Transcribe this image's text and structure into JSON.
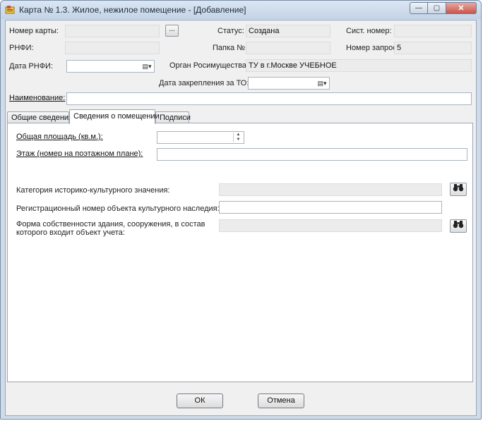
{
  "window": {
    "title": "Карта № 1.3. Жилое, нежилое помещение - [Добавление]",
    "minimize": "—",
    "maximize": "▢",
    "close": "✕"
  },
  "header": {
    "card_number_label": "Номер карты:",
    "card_number_value": "",
    "browse_button": "...",
    "status_label": "Статус:",
    "status_value": "Создана",
    "sys_number_label": "Сист. номер:",
    "sys_number_value": "",
    "rnfi_label": "РНФИ:",
    "rnfi_value": "",
    "folder_label": "Папка №:",
    "folder_value": "",
    "request_number_label": "Номер запроса:",
    "request_number_value": "5",
    "rnfi_date_label": "Дата РНФИ:",
    "rnfi_date_value": "",
    "authority_label": "Орган Росимущества:",
    "authority_value": "ТУ в г.Москве УЧЕБНОЕ",
    "assignment_date_label": "Дата закрепления за ТО:",
    "assignment_date_value": "",
    "name_label": "Наименование:",
    "name_value": ""
  },
  "tabs": [
    {
      "label": "Общие сведения"
    },
    {
      "label": "Сведения о помещении"
    },
    {
      "label": "Подписи"
    }
  ],
  "panel": {
    "area_label": "Общая площадь (кв.м.):",
    "area_value": "",
    "floor_label": "Этаж (номер на поэтажном плане):",
    "floor_value": "",
    "heritage_category_label": "Категория историко-культурного значения:",
    "heritage_category_value": "",
    "heritage_reg_label": "Регистрационный номер объекта культурного наследия:",
    "heritage_reg_value": "",
    "ownership_label_line1": "Форма собственности здания, сооружения, в состав",
    "ownership_label_line2": "которого входит объект учета:",
    "ownership_value": ""
  },
  "footer": {
    "ok_label": "ОК",
    "cancel_label": "Отмена"
  }
}
